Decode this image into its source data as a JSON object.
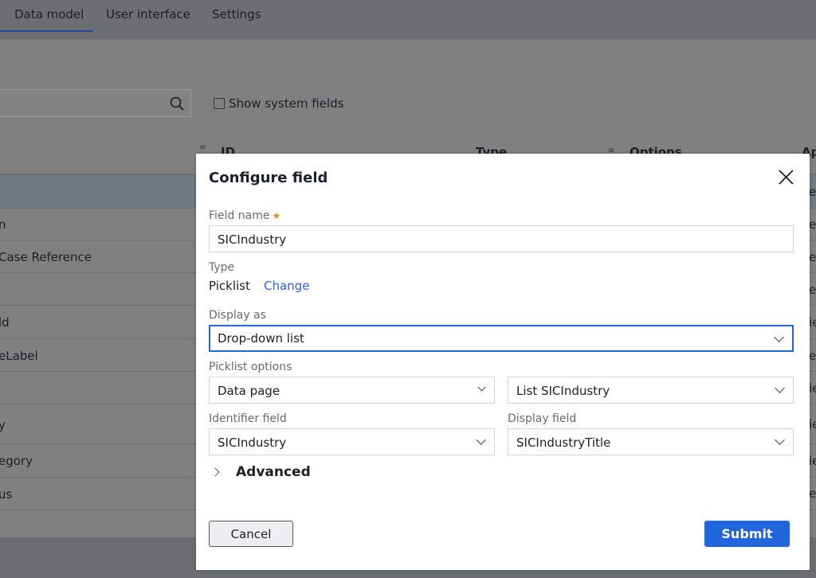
{
  "tabs": [
    {
      "label": "Data model",
      "active": true
    },
    {
      "label": "User interface"
    },
    {
      "label": "Settings"
    }
  ],
  "toolbar": {
    "search_placeholder": "",
    "show_system_fields": "Show system fields",
    "show_system_fields_checked": false
  },
  "table": {
    "columns": [
      "ID",
      "Type",
      "Options",
      "Ap"
    ],
    "rows": [
      {
        "name": "",
        "right": "e",
        "selected": true
      },
      {
        "name": "n",
        "right": "e"
      },
      {
        "name": "Case Reference",
        "right": "e"
      },
      {
        "name": "",
        "right": "e"
      },
      {
        "name": "ld",
        "right": "ie"
      },
      {
        "name": "eLabel",
        "right": "e"
      },
      {
        "name": "",
        "right": "ie"
      },
      {
        "name": "y",
        "right": "ie"
      },
      {
        "name": "egory",
        "right": "ie"
      },
      {
        "name": "us",
        "right": "e"
      }
    ]
  },
  "dialog": {
    "title": "Configure field",
    "field_name_label": "Field name",
    "required_mark": "★",
    "field_name_value": "SICIndustry",
    "type_label": "Type",
    "type_value": "Picklist",
    "change_link": "Change",
    "display_as_label": "Display as",
    "display_as_value": "Drop-down list",
    "picklist_options_label": "Picklist options",
    "picklist_source": "Data page",
    "picklist_datapage": "List SICIndustry",
    "identifier_field_label": "Identifier field",
    "identifier_field_value": "SICIndustry",
    "display_field_label": "Display field",
    "display_field_value": "SICIndustryTitle",
    "advanced_label": "Advanced",
    "cancel_label": "Cancel",
    "submit_label": "Submit"
  },
  "colors": {
    "accent": "#2266dd",
    "link": "#2b62e8",
    "required": "#e08a2b",
    "overlay": "#808080"
  }
}
